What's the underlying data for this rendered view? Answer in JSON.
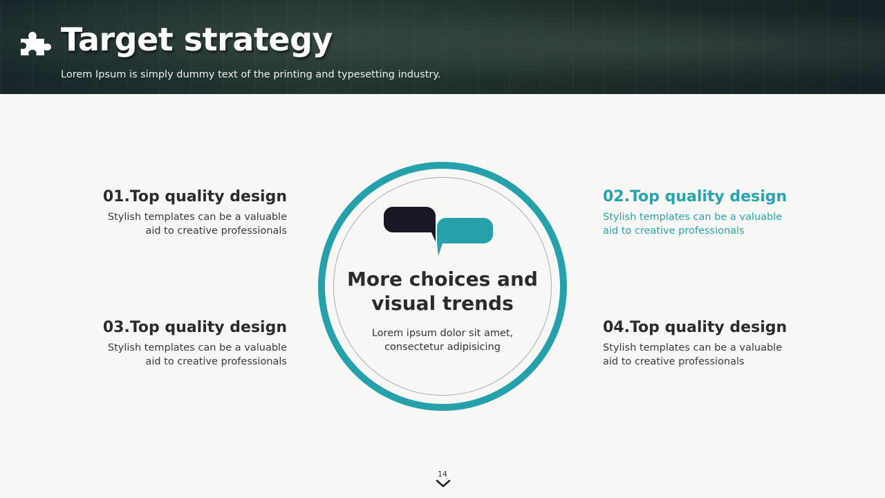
{
  "header": {
    "title": "Target strategy",
    "subtitle": "Lorem Ipsum is simply dummy text of the printing and typesetting industry.",
    "icon": "puzzle-icon"
  },
  "center": {
    "title_line1": "More choices and",
    "title_line2": "visual trends",
    "desc_line1": "Lorem ipsum dolor sit amet,",
    "desc_line2": "consectetur adipisicing",
    "icon": "speech-bubbles-icon"
  },
  "items": [
    {
      "title": "01.Top quality design",
      "desc_line1": "Stylish templates can be a valuable",
      "desc_line2": "aid to  creative professionals"
    },
    {
      "title": "02.Top quality design",
      "desc_line1": "Stylish templates can be a valuable",
      "desc_line2": "aid to  creative professionals"
    },
    {
      "title": "03.Top quality design",
      "desc_line1": "Stylish templates can be a valuable",
      "desc_line2": "aid to  creative professionals"
    },
    {
      "title": "04.Top quality design",
      "desc_line1": "Stylish templates can be a valuable",
      "desc_line2": "aid to  creative professionals"
    }
  ],
  "footer": {
    "page_number": "14",
    "icon": "chevron-down-icon"
  },
  "colors": {
    "accent": "#26a0ab",
    "dark_bubble": "#1a1628",
    "text_dark": "#2b2b2b",
    "header_bg": "#1c2c28"
  }
}
